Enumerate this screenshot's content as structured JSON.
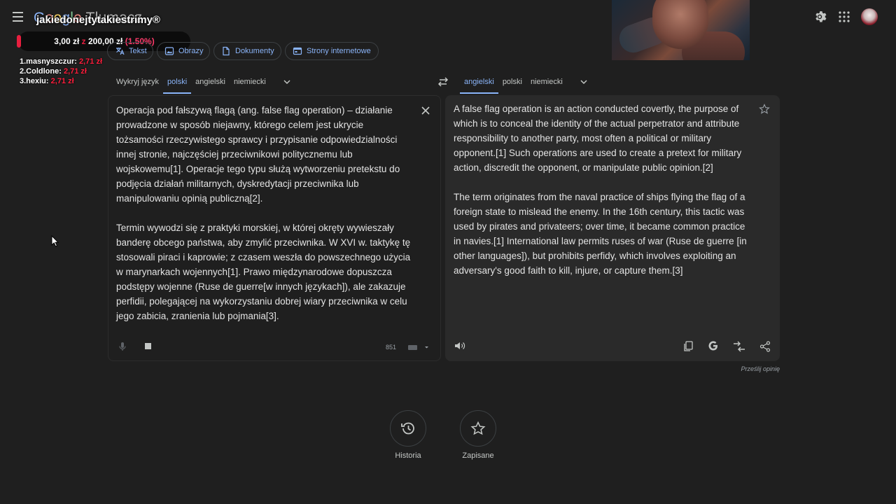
{
  "app": {
    "logo_text": "Google Tłumacz",
    "overlay_title": "jakiedonejtytakiestrimy®"
  },
  "donation": {
    "current": "3,00 zł",
    "separator": "z",
    "goal": "200,00 zł",
    "percent": "(1.50%)",
    "progress_fraction": 0.015,
    "ranks": [
      {
        "label": "1.masnyszczur:",
        "amount": "2,71 zł"
      },
      {
        "label": "2.Coldlone:",
        "amount": "2,71 zł"
      },
      {
        "label": "3.hexiu:",
        "amount": "2,71 zł"
      }
    ]
  },
  "modes": [
    {
      "label": "Tekst",
      "icon": "translate-icon"
    },
    {
      "label": "Obrazy",
      "icon": "image-icon"
    },
    {
      "label": "Dokumenty",
      "icon": "document-icon"
    },
    {
      "label": "Strony internetowe",
      "icon": "web-icon"
    }
  ],
  "source_langs": {
    "detect": "Wykryj język",
    "items": [
      "polski",
      "angielski",
      "niemiecki"
    ],
    "active": "polski"
  },
  "target_langs": {
    "items": [
      "angielski",
      "polski",
      "niemiecki"
    ],
    "active": "angielski"
  },
  "source": {
    "text": "Operacja pod fałszywą flagą (ang. false flag operation) – działanie\nprowadzone w sposób niejawny, którego celem jest ukrycie\ntożsamości rzeczywistego sprawcy i przypisanie odpowiedzialności\ninnej stronie, najczęściej przeciwnikowi politycznemu lub\nwojskowemu[1]. Operacje tego typu służą wytworzeniu pretekstu do\npodjęcia działań militarnych, dyskredytacji przeciwnika lub\nmanipulowaniu opinią publiczną[2].\n\nTermin wywodzi się z praktyki morskiej, w której okręty wywieszały\nbanderę obcego państwa, aby zmylić przeciwnika. W XVI w. taktykę tę\nstosowali piraci i kaprowie; z czasem weszła do powszechnego użycia\nw marynarkach wojennych[1]. Prawo międzynarodowe dopuszcza\npodstępy wojenne (Ruse de guerre[w innych językach]), ale zakazuje\nperfidii, polegającej na wykorzystaniu dobrej wiary przeciwnika w celu\njego zabicia, zranienia lub pojmania[3].",
    "char_count": "851"
  },
  "target": {
    "text": "A false flag operation is an action conducted covertly, the purpose of\nwhich is to conceal the identity of the actual perpetrator and attribute\nresponsibility to another party, most often a political or military\nopponent.[1] Such operations are used to create a pretext for military\naction, discredit the opponent, or manipulate public opinion.[2]\n\nThe term originates from the naval practice of ships flying the flag of a\nforeign state to mislead the enemy. In the 16th century, this tactic was\nused by pirates and privateers; over time, it became common practice\nin navies.[1] International law permits ruses of war (Ruse de guerre [in\nother languages]), but prohibits perfidy, which involves exploiting an\nadversary's good faith to kill, injure, or capture them.[3]"
  },
  "feedback_link": "Prześlij opinię",
  "bottom": {
    "history": "Historia",
    "saved": "Zapisane"
  }
}
